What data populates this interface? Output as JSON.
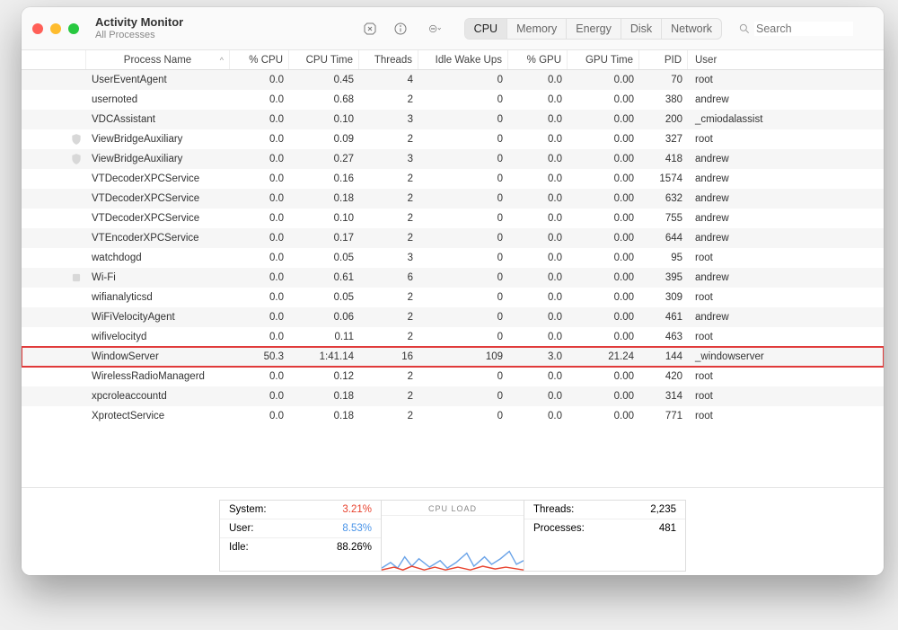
{
  "window": {
    "title": "Activity Monitor",
    "subtitle": "All Processes"
  },
  "tabs": [
    "CPU",
    "Memory",
    "Energy",
    "Disk",
    "Network"
  ],
  "active_tab": "CPU",
  "search_placeholder": "Search",
  "columns": [
    "Process Name",
    "% CPU",
    "CPU Time",
    "Threads",
    "Idle Wake Ups",
    "% GPU",
    "GPU Time",
    "PID",
    "User"
  ],
  "sort_indicator": "^",
  "rows": [
    {
      "icon": "",
      "name": "UserEventAgent",
      "cpu": "0.0",
      "cputime": "0.45",
      "threads": "4",
      "idle": "0",
      "gpu": "0.0",
      "gputime": "0.00",
      "pid": "70",
      "user": "root"
    },
    {
      "icon": "",
      "name": "usernoted",
      "cpu": "0.0",
      "cputime": "0.68",
      "threads": "2",
      "idle": "0",
      "gpu": "0.0",
      "gputime": "0.00",
      "pid": "380",
      "user": "andrew"
    },
    {
      "icon": "",
      "name": "VDCAssistant",
      "cpu": "0.0",
      "cputime": "0.10",
      "threads": "3",
      "idle": "0",
      "gpu": "0.0",
      "gputime": "0.00",
      "pid": "200",
      "user": "_cmiodalassist"
    },
    {
      "icon": "shield",
      "name": "ViewBridgeAuxiliary",
      "cpu": "0.0",
      "cputime": "0.09",
      "threads": "2",
      "idle": "0",
      "gpu": "0.0",
      "gputime": "0.00",
      "pid": "327",
      "user": "root"
    },
    {
      "icon": "shield",
      "name": "ViewBridgeAuxiliary",
      "cpu": "0.0",
      "cputime": "0.27",
      "threads": "3",
      "idle": "0",
      "gpu": "0.0",
      "gputime": "0.00",
      "pid": "418",
      "user": "andrew"
    },
    {
      "icon": "",
      "name": "VTDecoderXPCService",
      "cpu": "0.0",
      "cputime": "0.16",
      "threads": "2",
      "idle": "0",
      "gpu": "0.0",
      "gputime": "0.00",
      "pid": "1574",
      "user": "andrew"
    },
    {
      "icon": "",
      "name": "VTDecoderXPCService",
      "cpu": "0.0",
      "cputime": "0.18",
      "threads": "2",
      "idle": "0",
      "gpu": "0.0",
      "gputime": "0.00",
      "pid": "632",
      "user": "andrew"
    },
    {
      "icon": "",
      "name": "VTDecoderXPCService",
      "cpu": "0.0",
      "cputime": "0.10",
      "threads": "2",
      "idle": "0",
      "gpu": "0.0",
      "gputime": "0.00",
      "pid": "755",
      "user": "andrew"
    },
    {
      "icon": "",
      "name": "VTEncoderXPCService",
      "cpu": "0.0",
      "cputime": "0.17",
      "threads": "2",
      "idle": "0",
      "gpu": "0.0",
      "gputime": "0.00",
      "pid": "644",
      "user": "andrew"
    },
    {
      "icon": "",
      "name": "watchdogd",
      "cpu": "0.0",
      "cputime": "0.05",
      "threads": "3",
      "idle": "0",
      "gpu": "0.0",
      "gputime": "0.00",
      "pid": "95",
      "user": "root"
    },
    {
      "icon": "square",
      "name": "Wi-Fi",
      "cpu": "0.0",
      "cputime": "0.61",
      "threads": "6",
      "idle": "0",
      "gpu": "0.0",
      "gputime": "0.00",
      "pid": "395",
      "user": "andrew"
    },
    {
      "icon": "",
      "name": "wifianalyticsd",
      "cpu": "0.0",
      "cputime": "0.05",
      "threads": "2",
      "idle": "0",
      "gpu": "0.0",
      "gputime": "0.00",
      "pid": "309",
      "user": "root"
    },
    {
      "icon": "",
      "name": "WiFiVelocityAgent",
      "cpu": "0.0",
      "cputime": "0.06",
      "threads": "2",
      "idle": "0",
      "gpu": "0.0",
      "gputime": "0.00",
      "pid": "461",
      "user": "andrew"
    },
    {
      "icon": "",
      "name": "wifivelocityd",
      "cpu": "0.0",
      "cputime": "0.11",
      "threads": "2",
      "idle": "0",
      "gpu": "0.0",
      "gputime": "0.00",
      "pid": "463",
      "user": "root"
    },
    {
      "icon": "",
      "name": "WindowServer",
      "cpu": "50.3",
      "cputime": "1:41.14",
      "threads": "16",
      "idle": "109",
      "gpu": "3.0",
      "gputime": "21.24",
      "pid": "144",
      "user": "_windowserver",
      "highlight": true
    },
    {
      "icon": "",
      "name": "WirelessRadioManagerd",
      "cpu": "0.0",
      "cputime": "0.12",
      "threads": "2",
      "idle": "0",
      "gpu": "0.0",
      "gputime": "0.00",
      "pid": "420",
      "user": "root"
    },
    {
      "icon": "",
      "name": "xpcroleaccountd",
      "cpu": "0.0",
      "cputime": "0.18",
      "threads": "2",
      "idle": "0",
      "gpu": "0.0",
      "gputime": "0.00",
      "pid": "314",
      "user": "root"
    },
    {
      "icon": "",
      "name": "XprotectService",
      "cpu": "0.0",
      "cputime": "0.18",
      "threads": "2",
      "idle": "0",
      "gpu": "0.0",
      "gputime": "0.00",
      "pid": "771",
      "user": "root"
    }
  ],
  "footer": {
    "system_label": "System:",
    "system_value": "3.21%",
    "user_label": "User:",
    "user_value": "8.53%",
    "idle_label": "Idle:",
    "idle_value": "88.26%",
    "chart_label": "CPU LOAD",
    "threads_label": "Threads:",
    "threads_value": "2,235",
    "processes_label": "Processes:",
    "processes_value": "481"
  }
}
